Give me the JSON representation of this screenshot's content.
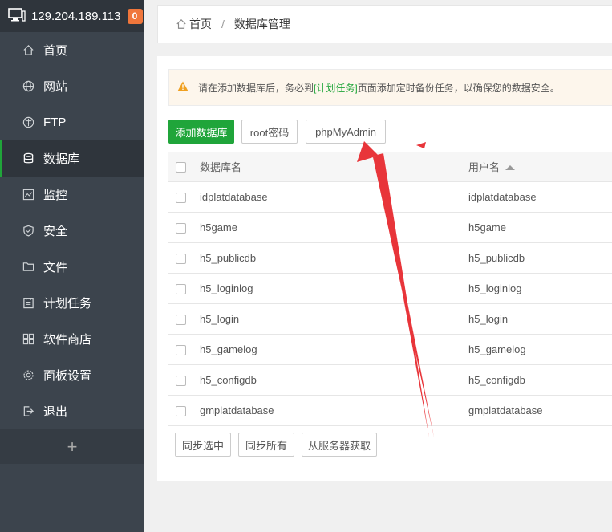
{
  "topbar": {
    "ip": "129.204.189.113",
    "badge": "0"
  },
  "menu": {
    "items": [
      {
        "label": "首页",
        "icon": "home-icon"
      },
      {
        "label": "网站",
        "icon": "globe-icon"
      },
      {
        "label": "FTP",
        "icon": "ftp-icon"
      },
      {
        "label": "数据库",
        "icon": "database-icon"
      },
      {
        "label": "监控",
        "icon": "monitor-icon"
      },
      {
        "label": "安全",
        "icon": "shield-icon"
      },
      {
        "label": "文件",
        "icon": "folder-icon"
      },
      {
        "label": "计划任务",
        "icon": "calendar-icon"
      },
      {
        "label": "软件商店",
        "icon": "apps-icon"
      },
      {
        "label": "面板设置",
        "icon": "gear-icon"
      },
      {
        "label": "退出",
        "icon": "logout-icon"
      }
    ],
    "active_index": 3,
    "add_label": "+"
  },
  "breadcrumb": {
    "home": "首页",
    "separator": "/",
    "current": "数据库管理"
  },
  "alert": {
    "text_before": "请在添加数据库后，务必到",
    "link": "[计划任务]",
    "text_after": "页面添加定时备份任务，以确保您的数据安全。"
  },
  "toolbar": {
    "add_db": "添加数据库",
    "root_pwd": "root密码",
    "phpmyadmin": "phpMyAdmin"
  },
  "table": {
    "headers": [
      "数据库名",
      "用户名"
    ],
    "rows": [
      [
        "idplatdatabase",
        "idplatdatabase"
      ],
      [
        "h5game",
        "h5game"
      ],
      [
        "h5_publicdb",
        "h5_publicdb"
      ],
      [
        "h5_loginlog",
        "h5_loginlog"
      ],
      [
        "h5_login",
        "h5_login"
      ],
      [
        "h5_gamelog",
        "h5_gamelog"
      ],
      [
        "h5_configdb",
        "h5_configdb"
      ],
      [
        "gmplatdatabase",
        "gmplatdatabase"
      ]
    ]
  },
  "footer_buttons": {
    "sync_selected": "同步选中",
    "sync_all": "同步所有",
    "fetch_server": "从服务器获取"
  },
  "colors": {
    "accent": "#20a53a",
    "sidebar": "#3c444d",
    "badge": "#f0763b",
    "annotation": "#e8353a"
  }
}
